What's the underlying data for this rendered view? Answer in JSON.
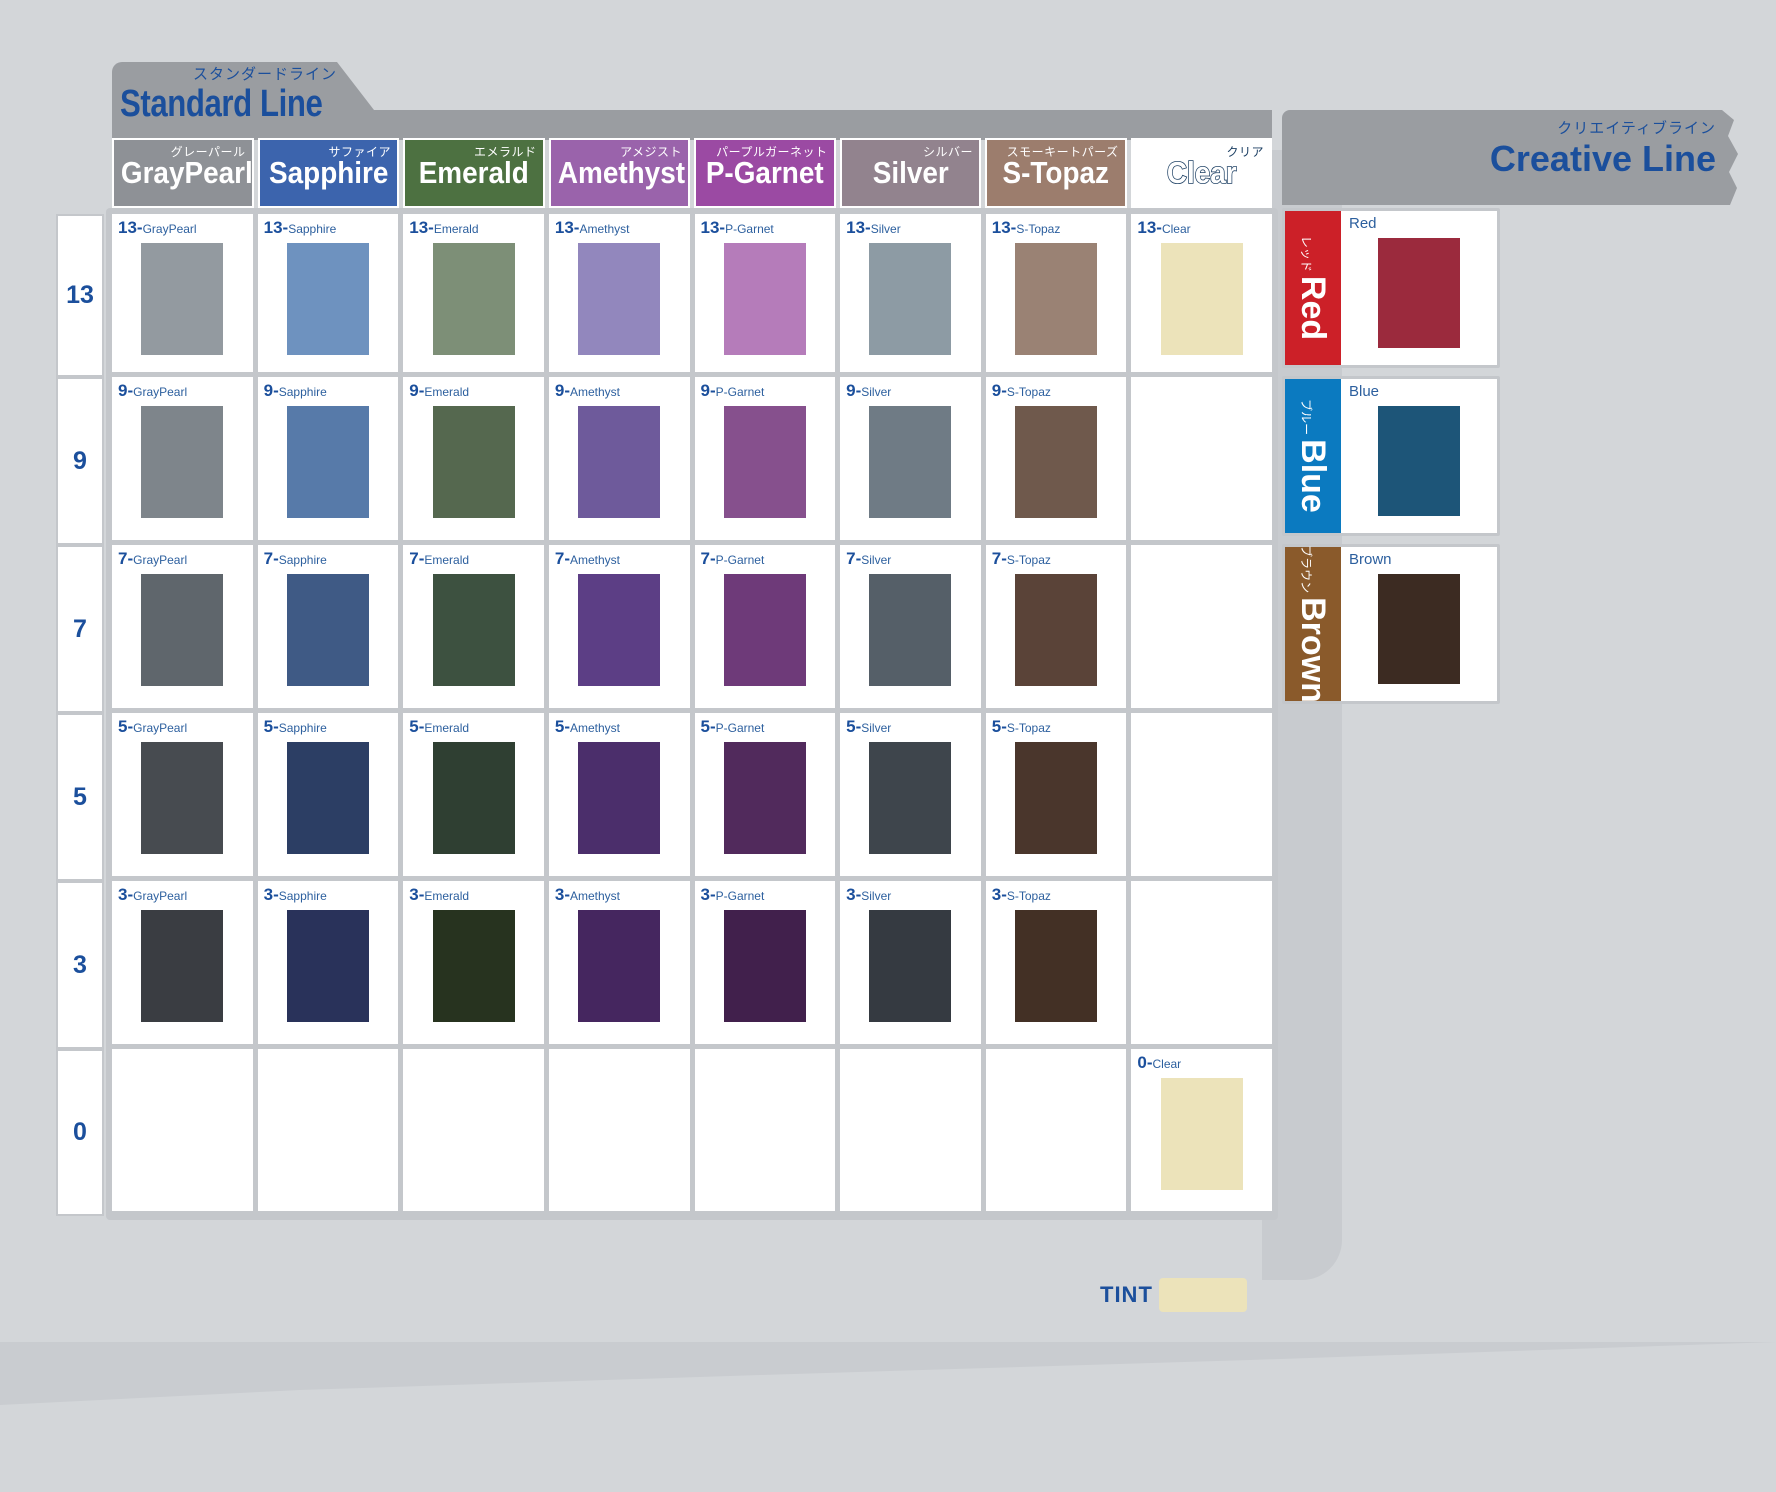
{
  "standard_line": {
    "jp": "スタンダードライン",
    "en": "Standard Line",
    "columns": [
      {
        "jp": "グレーパール",
        "en": "GrayPearl",
        "key": "GrayPearl",
        "header_color": "#8e9196"
      },
      {
        "jp": "サファイア",
        "en": "Sapphire",
        "key": "Sapphire",
        "header_color": "#3c64ad"
      },
      {
        "jp": "エメラルド",
        "en": "Emerald",
        "key": "Emerald",
        "header_color": "#4d7141"
      },
      {
        "jp": "アメジスト",
        "en": "Amethyst",
        "key": "Amethyst",
        "header_color": "#9a63ab"
      },
      {
        "jp": "パープルガーネット",
        "en": "P-Garnet",
        "key": "P-Garnet",
        "header_color": "#9b4aa3"
      },
      {
        "jp": "シルバー",
        "en": "Silver",
        "key": "Silver",
        "header_color": "#92838e"
      },
      {
        "jp": "スモーキートパーズ",
        "en": "S-Topaz",
        "key": "S-Topaz",
        "header_color": "#9c7d6d"
      },
      {
        "jp": "クリア",
        "en": "Clear",
        "key": "Clear",
        "header_color": "#ffffff"
      }
    ],
    "levels": [
      "13",
      "9",
      "7",
      "5",
      "3",
      "0"
    ],
    "swatches": {
      "13": {
        "GrayPearl": "#939aa0",
        "Sapphire": "#6e92bf",
        "Emerald": "#7d8f77",
        "Amethyst": "#9287bd",
        "P-Garnet": "#b57cba",
        "Silver": "#8d9ba4",
        "S-Topaz": "#9a8274",
        "Clear": "#ece3ba"
      },
      "9": {
        "GrayPearl": "#7e858b",
        "Sapphire": "#577aa9",
        "Emerald": "#55684f",
        "Amethyst": "#6e5a9b",
        "P-Garnet": "#86508d",
        "Silver": "#6f7b85",
        "S-Topaz": "#6f594c",
        "Clear": null
      },
      "7": {
        "GrayPearl": "#5f666c",
        "Sapphire": "#3f5a85",
        "Emerald": "#3d5140",
        "Amethyst": "#5c3e85",
        "P-Garnet": "#6e3a79",
        "Silver": "#555f68",
        "S-Topaz": "#5a4338",
        "Clear": null
      },
      "5": {
        "GrayPearl": "#474b50",
        "Sapphire": "#2c3e64",
        "Emerald": "#2f3f32",
        "Amethyst": "#4b2e6b",
        "P-Garnet": "#512a5c",
        "Silver": "#3e454c",
        "S-Topaz": "#4a362c",
        "Clear": null
      },
      "3": {
        "GrayPearl": "#3a3d42",
        "Sapphire": "#29325a",
        "Emerald": "#27331f",
        "Amethyst": "#45265f",
        "P-Garnet": "#41204c",
        "Silver": "#353a41",
        "S-Topaz": "#433025",
        "Clear": null
      },
      "0": {
        "GrayPearl": null,
        "Sapphire": null,
        "Emerald": null,
        "Amethyst": null,
        "P-Garnet": null,
        "Silver": null,
        "S-Topaz": null,
        "Clear": "#ece3ba"
      }
    }
  },
  "creative_line": {
    "jp": "クリエイティブライン",
    "en": "Creative Line",
    "cards": [
      {
        "jp": "レッド",
        "en": "Red",
        "tab_color": "#cc2028",
        "label": "Red",
        "swatch": "#9b2a3d"
      },
      {
        "jp": "ブルー",
        "en": "Blue",
        "tab_color": "#0b7ac0",
        "label": "Blue",
        "swatch": "#1d5578"
      },
      {
        "jp": "ブラウン",
        "en": "Brown",
        "tab_color": "#8a5a2b",
        "label": "Brown",
        "swatch": "#3c2b22"
      }
    ]
  },
  "tint": {
    "label": "TINT",
    "swatch": "#ece3ba"
  },
  "theme": {
    "accent_blue": "#1b4f9c",
    "label_blue": "#2c5f9e",
    "panel_gray": "#9a9da1",
    "page_bg": "#d3d6d9",
    "border_gray": "#c4c7cb"
  }
}
